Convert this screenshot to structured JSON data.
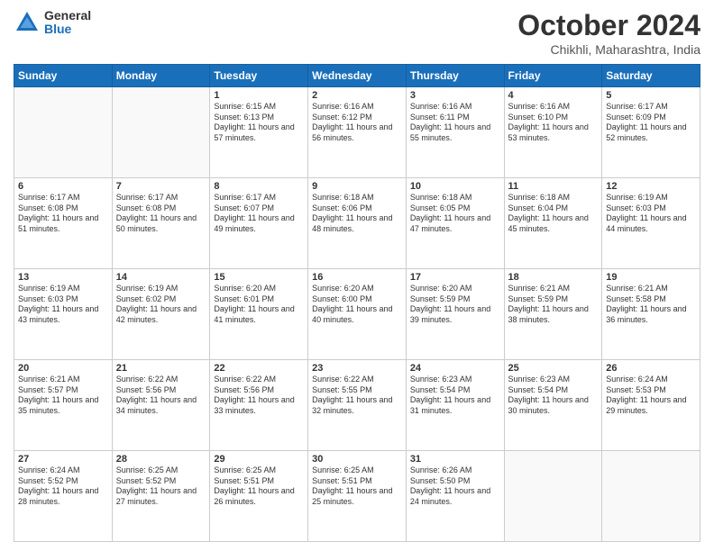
{
  "logo": {
    "general": "General",
    "blue": "Blue"
  },
  "title": {
    "month_year": "October 2024",
    "location": "Chikhli, Maharashtra, India"
  },
  "weekdays": [
    "Sunday",
    "Monday",
    "Tuesday",
    "Wednesday",
    "Thursday",
    "Friday",
    "Saturday"
  ],
  "weeks": [
    [
      {
        "day": "",
        "sunrise": "",
        "sunset": "",
        "daylight": ""
      },
      {
        "day": "",
        "sunrise": "",
        "sunset": "",
        "daylight": ""
      },
      {
        "day": "1",
        "sunrise": "Sunrise: 6:15 AM",
        "sunset": "Sunset: 6:13 PM",
        "daylight": "Daylight: 11 hours and 57 minutes."
      },
      {
        "day": "2",
        "sunrise": "Sunrise: 6:16 AM",
        "sunset": "Sunset: 6:12 PM",
        "daylight": "Daylight: 11 hours and 56 minutes."
      },
      {
        "day": "3",
        "sunrise": "Sunrise: 6:16 AM",
        "sunset": "Sunset: 6:11 PM",
        "daylight": "Daylight: 11 hours and 55 minutes."
      },
      {
        "day": "4",
        "sunrise": "Sunrise: 6:16 AM",
        "sunset": "Sunset: 6:10 PM",
        "daylight": "Daylight: 11 hours and 53 minutes."
      },
      {
        "day": "5",
        "sunrise": "Sunrise: 6:17 AM",
        "sunset": "Sunset: 6:09 PM",
        "daylight": "Daylight: 11 hours and 52 minutes."
      }
    ],
    [
      {
        "day": "6",
        "sunrise": "Sunrise: 6:17 AM",
        "sunset": "Sunset: 6:08 PM",
        "daylight": "Daylight: 11 hours and 51 minutes."
      },
      {
        "day": "7",
        "sunrise": "Sunrise: 6:17 AM",
        "sunset": "Sunset: 6:08 PM",
        "daylight": "Daylight: 11 hours and 50 minutes."
      },
      {
        "day": "8",
        "sunrise": "Sunrise: 6:17 AM",
        "sunset": "Sunset: 6:07 PM",
        "daylight": "Daylight: 11 hours and 49 minutes."
      },
      {
        "day": "9",
        "sunrise": "Sunrise: 6:18 AM",
        "sunset": "Sunset: 6:06 PM",
        "daylight": "Daylight: 11 hours and 48 minutes."
      },
      {
        "day": "10",
        "sunrise": "Sunrise: 6:18 AM",
        "sunset": "Sunset: 6:05 PM",
        "daylight": "Daylight: 11 hours and 47 minutes."
      },
      {
        "day": "11",
        "sunrise": "Sunrise: 6:18 AM",
        "sunset": "Sunset: 6:04 PM",
        "daylight": "Daylight: 11 hours and 45 minutes."
      },
      {
        "day": "12",
        "sunrise": "Sunrise: 6:19 AM",
        "sunset": "Sunset: 6:03 PM",
        "daylight": "Daylight: 11 hours and 44 minutes."
      }
    ],
    [
      {
        "day": "13",
        "sunrise": "Sunrise: 6:19 AM",
        "sunset": "Sunset: 6:03 PM",
        "daylight": "Daylight: 11 hours and 43 minutes."
      },
      {
        "day": "14",
        "sunrise": "Sunrise: 6:19 AM",
        "sunset": "Sunset: 6:02 PM",
        "daylight": "Daylight: 11 hours and 42 minutes."
      },
      {
        "day": "15",
        "sunrise": "Sunrise: 6:20 AM",
        "sunset": "Sunset: 6:01 PM",
        "daylight": "Daylight: 11 hours and 41 minutes."
      },
      {
        "day": "16",
        "sunrise": "Sunrise: 6:20 AM",
        "sunset": "Sunset: 6:00 PM",
        "daylight": "Daylight: 11 hours and 40 minutes."
      },
      {
        "day": "17",
        "sunrise": "Sunrise: 6:20 AM",
        "sunset": "Sunset: 5:59 PM",
        "daylight": "Daylight: 11 hours and 39 minutes."
      },
      {
        "day": "18",
        "sunrise": "Sunrise: 6:21 AM",
        "sunset": "Sunset: 5:59 PM",
        "daylight": "Daylight: 11 hours and 38 minutes."
      },
      {
        "day": "19",
        "sunrise": "Sunrise: 6:21 AM",
        "sunset": "Sunset: 5:58 PM",
        "daylight": "Daylight: 11 hours and 36 minutes."
      }
    ],
    [
      {
        "day": "20",
        "sunrise": "Sunrise: 6:21 AM",
        "sunset": "Sunset: 5:57 PM",
        "daylight": "Daylight: 11 hours and 35 minutes."
      },
      {
        "day": "21",
        "sunrise": "Sunrise: 6:22 AM",
        "sunset": "Sunset: 5:56 PM",
        "daylight": "Daylight: 11 hours and 34 minutes."
      },
      {
        "day": "22",
        "sunrise": "Sunrise: 6:22 AM",
        "sunset": "Sunset: 5:56 PM",
        "daylight": "Daylight: 11 hours and 33 minutes."
      },
      {
        "day": "23",
        "sunrise": "Sunrise: 6:22 AM",
        "sunset": "Sunset: 5:55 PM",
        "daylight": "Daylight: 11 hours and 32 minutes."
      },
      {
        "day": "24",
        "sunrise": "Sunrise: 6:23 AM",
        "sunset": "Sunset: 5:54 PM",
        "daylight": "Daylight: 11 hours and 31 minutes."
      },
      {
        "day": "25",
        "sunrise": "Sunrise: 6:23 AM",
        "sunset": "Sunset: 5:54 PM",
        "daylight": "Daylight: 11 hours and 30 minutes."
      },
      {
        "day": "26",
        "sunrise": "Sunrise: 6:24 AM",
        "sunset": "Sunset: 5:53 PM",
        "daylight": "Daylight: 11 hours and 29 minutes."
      }
    ],
    [
      {
        "day": "27",
        "sunrise": "Sunrise: 6:24 AM",
        "sunset": "Sunset: 5:52 PM",
        "daylight": "Daylight: 11 hours and 28 minutes."
      },
      {
        "day": "28",
        "sunrise": "Sunrise: 6:25 AM",
        "sunset": "Sunset: 5:52 PM",
        "daylight": "Daylight: 11 hours and 27 minutes."
      },
      {
        "day": "29",
        "sunrise": "Sunrise: 6:25 AM",
        "sunset": "Sunset: 5:51 PM",
        "daylight": "Daylight: 11 hours and 26 minutes."
      },
      {
        "day": "30",
        "sunrise": "Sunrise: 6:25 AM",
        "sunset": "Sunset: 5:51 PM",
        "daylight": "Daylight: 11 hours and 25 minutes."
      },
      {
        "day": "31",
        "sunrise": "Sunrise: 6:26 AM",
        "sunset": "Sunset: 5:50 PM",
        "daylight": "Daylight: 11 hours and 24 minutes."
      },
      {
        "day": "",
        "sunrise": "",
        "sunset": "",
        "daylight": ""
      },
      {
        "day": "",
        "sunrise": "",
        "sunset": "",
        "daylight": ""
      }
    ]
  ]
}
